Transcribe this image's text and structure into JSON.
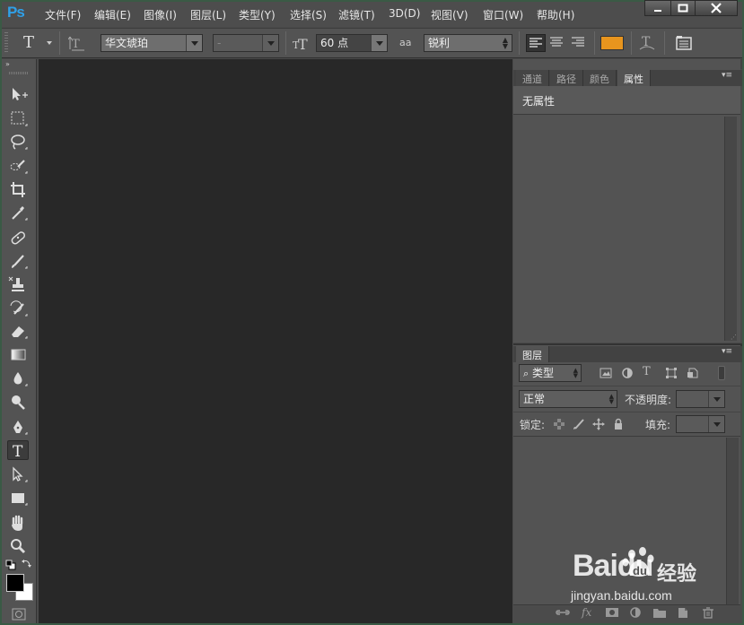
{
  "app": {
    "logo": "Ps"
  },
  "menu": [
    "文件(F)",
    "编辑(E)",
    "图像(I)",
    "图层(L)",
    "类型(Y)",
    "选择(S)",
    "滤镜(T)",
    "3D(D)",
    "视图(V)",
    "窗口(W)",
    "帮助(H)"
  ],
  "options": {
    "tool_glyph": "T",
    "font_family": "华文琥珀",
    "font_style": "-",
    "font_size": "60 点",
    "aa_icon": "aa",
    "antialias": "锐利",
    "text_color": "#e8951e"
  },
  "properties_panel": {
    "tabs": [
      "通道",
      "路径",
      "颜色",
      "属性"
    ],
    "active_tab": "属性",
    "content": "无属性"
  },
  "layers_panel": {
    "tab": "图层",
    "filter": "类型",
    "blend_mode": "正常",
    "opacity_label": "不透明度:",
    "lock_label": "锁定:",
    "fill_label": "填充:"
  },
  "watermark": {
    "brand": "Baidu",
    "suffix": "经验",
    "url": "jingyan.baidu.com"
  }
}
